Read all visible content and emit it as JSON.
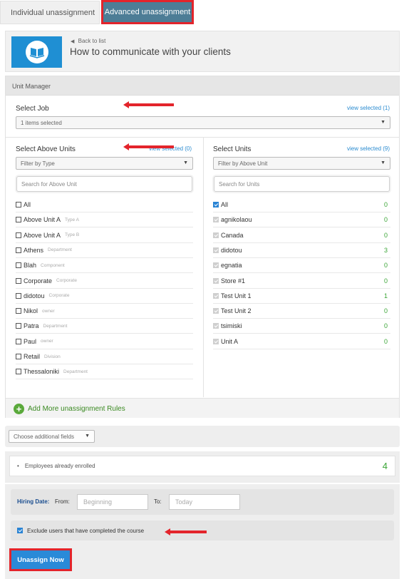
{
  "tabs": {
    "individual": "Individual unassignment",
    "advanced": "Advanced unassignment"
  },
  "header": {
    "back_label": "Back to list",
    "title": "How to communicate with your clients"
  },
  "unit_manager": {
    "title": "Unit Manager",
    "select_job": {
      "label": "Select Job",
      "view_selected": "view selected (1)",
      "dropdown_value": "1 items selected"
    },
    "above_units": {
      "label": "Select Above Units",
      "view_selected": "view selected (0)",
      "filter": "Filter by Type",
      "search_placeholder": "Search for Above Unit",
      "items": [
        {
          "label": "All",
          "type": ""
        },
        {
          "label": "Above Unit A",
          "type": "Type A"
        },
        {
          "label": "Above Unit A",
          "type": "Type B"
        },
        {
          "label": "Athens",
          "type": "Department"
        },
        {
          "label": "Blah",
          "type": "Component"
        },
        {
          "label": "Corporate",
          "type": "Corporate"
        },
        {
          "label": "didotou",
          "type": "Corporate"
        },
        {
          "label": "Nikol",
          "type": "owner"
        },
        {
          "label": "Patra",
          "type": "Department"
        },
        {
          "label": "Paul",
          "type": "owner"
        },
        {
          "label": "Retail",
          "type": "Division"
        },
        {
          "label": "Thessaloniki",
          "type": "Department"
        }
      ]
    },
    "units": {
      "label": "Select Units",
      "view_selected": "view selected (9)",
      "filter": "Filter by Above Unit",
      "search_placeholder": "Search for Units",
      "items": [
        {
          "label": "All",
          "count": "0"
        },
        {
          "label": "agnikolaou",
          "count": "0"
        },
        {
          "label": "Canada",
          "count": "0"
        },
        {
          "label": "didotou",
          "count": "3"
        },
        {
          "label": "egnatia",
          "count": "0"
        },
        {
          "label": "Store #1",
          "count": "0"
        },
        {
          "label": "Test Unit 1",
          "count": "1"
        },
        {
          "label": "Test Unit 2",
          "count": "0"
        },
        {
          "label": "tsimiski",
          "count": "0"
        },
        {
          "label": "Unit A",
          "count": "0"
        }
      ]
    },
    "add_rules": "Add More unassignment Rules"
  },
  "additional_fields": "Choose additional fields",
  "enrolled": {
    "label": "Employees already enrolled",
    "count": "4"
  },
  "hiring": {
    "label": "Hiring Date:",
    "from_label": "From:",
    "from_placeholder": "Beginning",
    "to_label": "To:",
    "to_placeholder": "Today"
  },
  "exclude_label": "Exclude users that have completed the course",
  "unassign_button": "Unassign Now",
  "colors": {
    "accent": "#2a8ad8",
    "tab_active": "#4d7d96",
    "highlight": "#e3242b",
    "count_green": "#3aa536"
  }
}
